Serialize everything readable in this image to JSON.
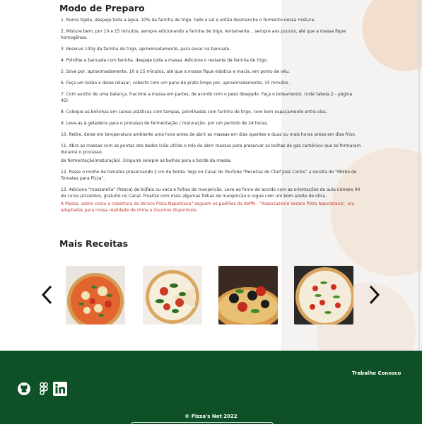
{
  "sections": {
    "prep_title": "Modo de Preparo",
    "more_title": "Mais Receitas"
  },
  "steps": [
    "1. Numa tigela, despeje toda a água, 10% da farinha de trigo, todo o sal e então desmanche o fermento nessa mistura.",
    "2. Misture bem, por 10 a 15 minutos, sempre adicionando a farinha de trigo, lentamente... sempre aos poucos, até que a massa fique homogênea.",
    "3. Reserve 100g da farinha de trigo, aproximadamente, para sovar na bancada.",
    "4. Polvilhe a bancada com farinha, despeje toda a massa. Adicione o restante da farinha de trigo.",
    "5. Sove por, aproximadamente, 10 a 15 minutos, até que a massa fique elástica e macia, em ponto de véu.",
    "6. Faça um bolão e deixe relaxar, coberto com um pano de prato limpo por, aproximadamente, 15 minutos .",
    "7. Com auxílio de uma balança, fracione a massa em partes, de acordo com o peso desejado. Faça o boleamento. (vide tabela 2 - página 45).",
    "8. Coloque as bolinhas em caixas plásticas com tampas, polvilhadas com farinha de trigo, com bom espaçamento entre elas.",
    "9. Leve-as à geladeira para o processo de fermentação / maturação, por um período de 24 horas.",
    "10. Retire, deixe em temperatura ambiente uma hora antes de abrir as massas em dias quentes e duas ou mais horas antes em dias frios.",
    "11. Abra as massas com as pontas dos dedos (não utilize o rolo de abrir massas para preservar as bolhas de gás carbônico que se formaram durante o processo.",
    "da fermentação/maturação). Empurre sempre as bolhas para a borda da massa.",
    "12. Passe o molho de tomates preservando 2 cm de borda. Veja no Canal do YouTube \"Receitas do Chef José Carlos\" a receita do \"Molho de Tomates para Pizza\".",
    "13. Adicione \"mozzarella\" (fresca) de búfala ou vaca e folhas de manjericão. Leve ao forno de acordo com as orientações da aula número 04 do curso pizzaiolos, gratuito no Canal. Finalize com mais algumas folhas de manjericão e regue com um bom azeite de oliva."
  ],
  "note": "A Massa, assim como a cobertura da Verace Pizza Napolitana\" seguem os padrões da AVPN – \"Associazione Verace Pizza Napoletana\", ora adaptadas para nossa realidade de clima e insumos disponíveis.",
  "carousel": {
    "prev_icon": "chevron-left-icon",
    "next_icon": "chevron-right-icon",
    "items": [
      "pizza-margherita-photo",
      "pizza-slice-basil-photo",
      "pizza-olives-tomato-photo",
      "pizza-white-tomato-photo"
    ]
  },
  "footer": {
    "work_link": "Trabalhe Conosco",
    "copyright": "© Pizza's Net 2022",
    "social_icons": [
      "github-icon",
      "figma-icon",
      "linkedin-icon"
    ]
  },
  "colors": {
    "footer_bg": "#0f5126",
    "note_text": "#c0392b"
  }
}
